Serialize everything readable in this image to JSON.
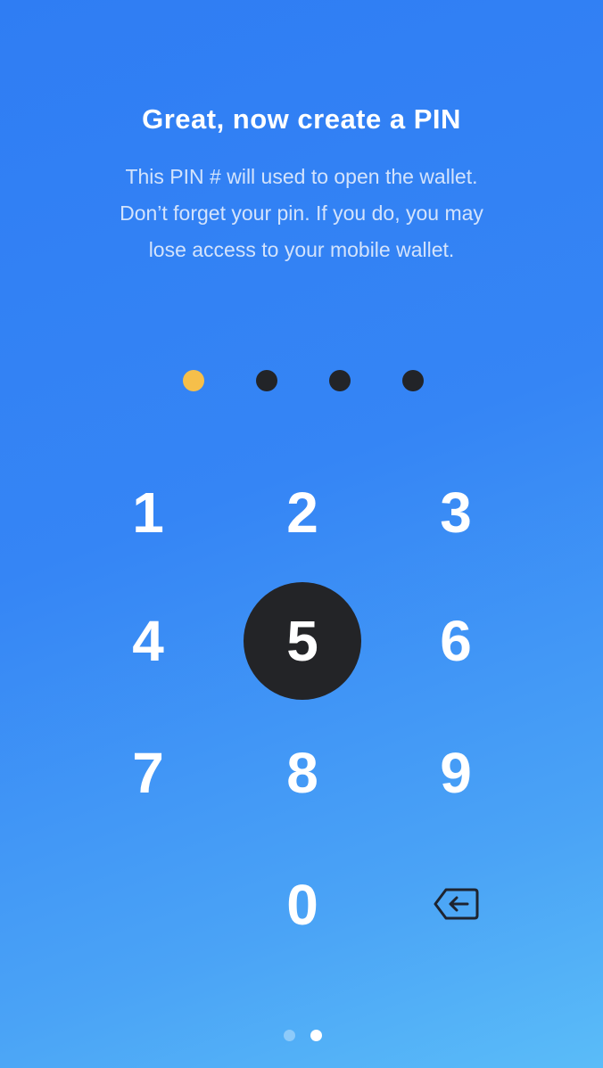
{
  "header": {
    "title": "Great, now create a PIN",
    "description_lines": [
      "This PIN # will used to open the wallet.",
      "Don’t forget your pin. If you do, you may",
      "lose access to your mobile wallet."
    ]
  },
  "pin": {
    "length": 4,
    "entered": 1,
    "filled_color": "#f6bf4a",
    "empty_color": "#222428"
  },
  "keypad": {
    "keys": [
      "1",
      "2",
      "3",
      "4",
      "5",
      "6",
      "7",
      "8",
      "9",
      "0"
    ],
    "pressed_key": "5",
    "backspace_icon": "backspace-icon"
  },
  "pager": {
    "total": 2,
    "active_index": 1
  },
  "colors": {
    "background_top": "#2f7df3",
    "background_bottom": "#5abcf8",
    "pressed_key_bg": "#232427"
  }
}
